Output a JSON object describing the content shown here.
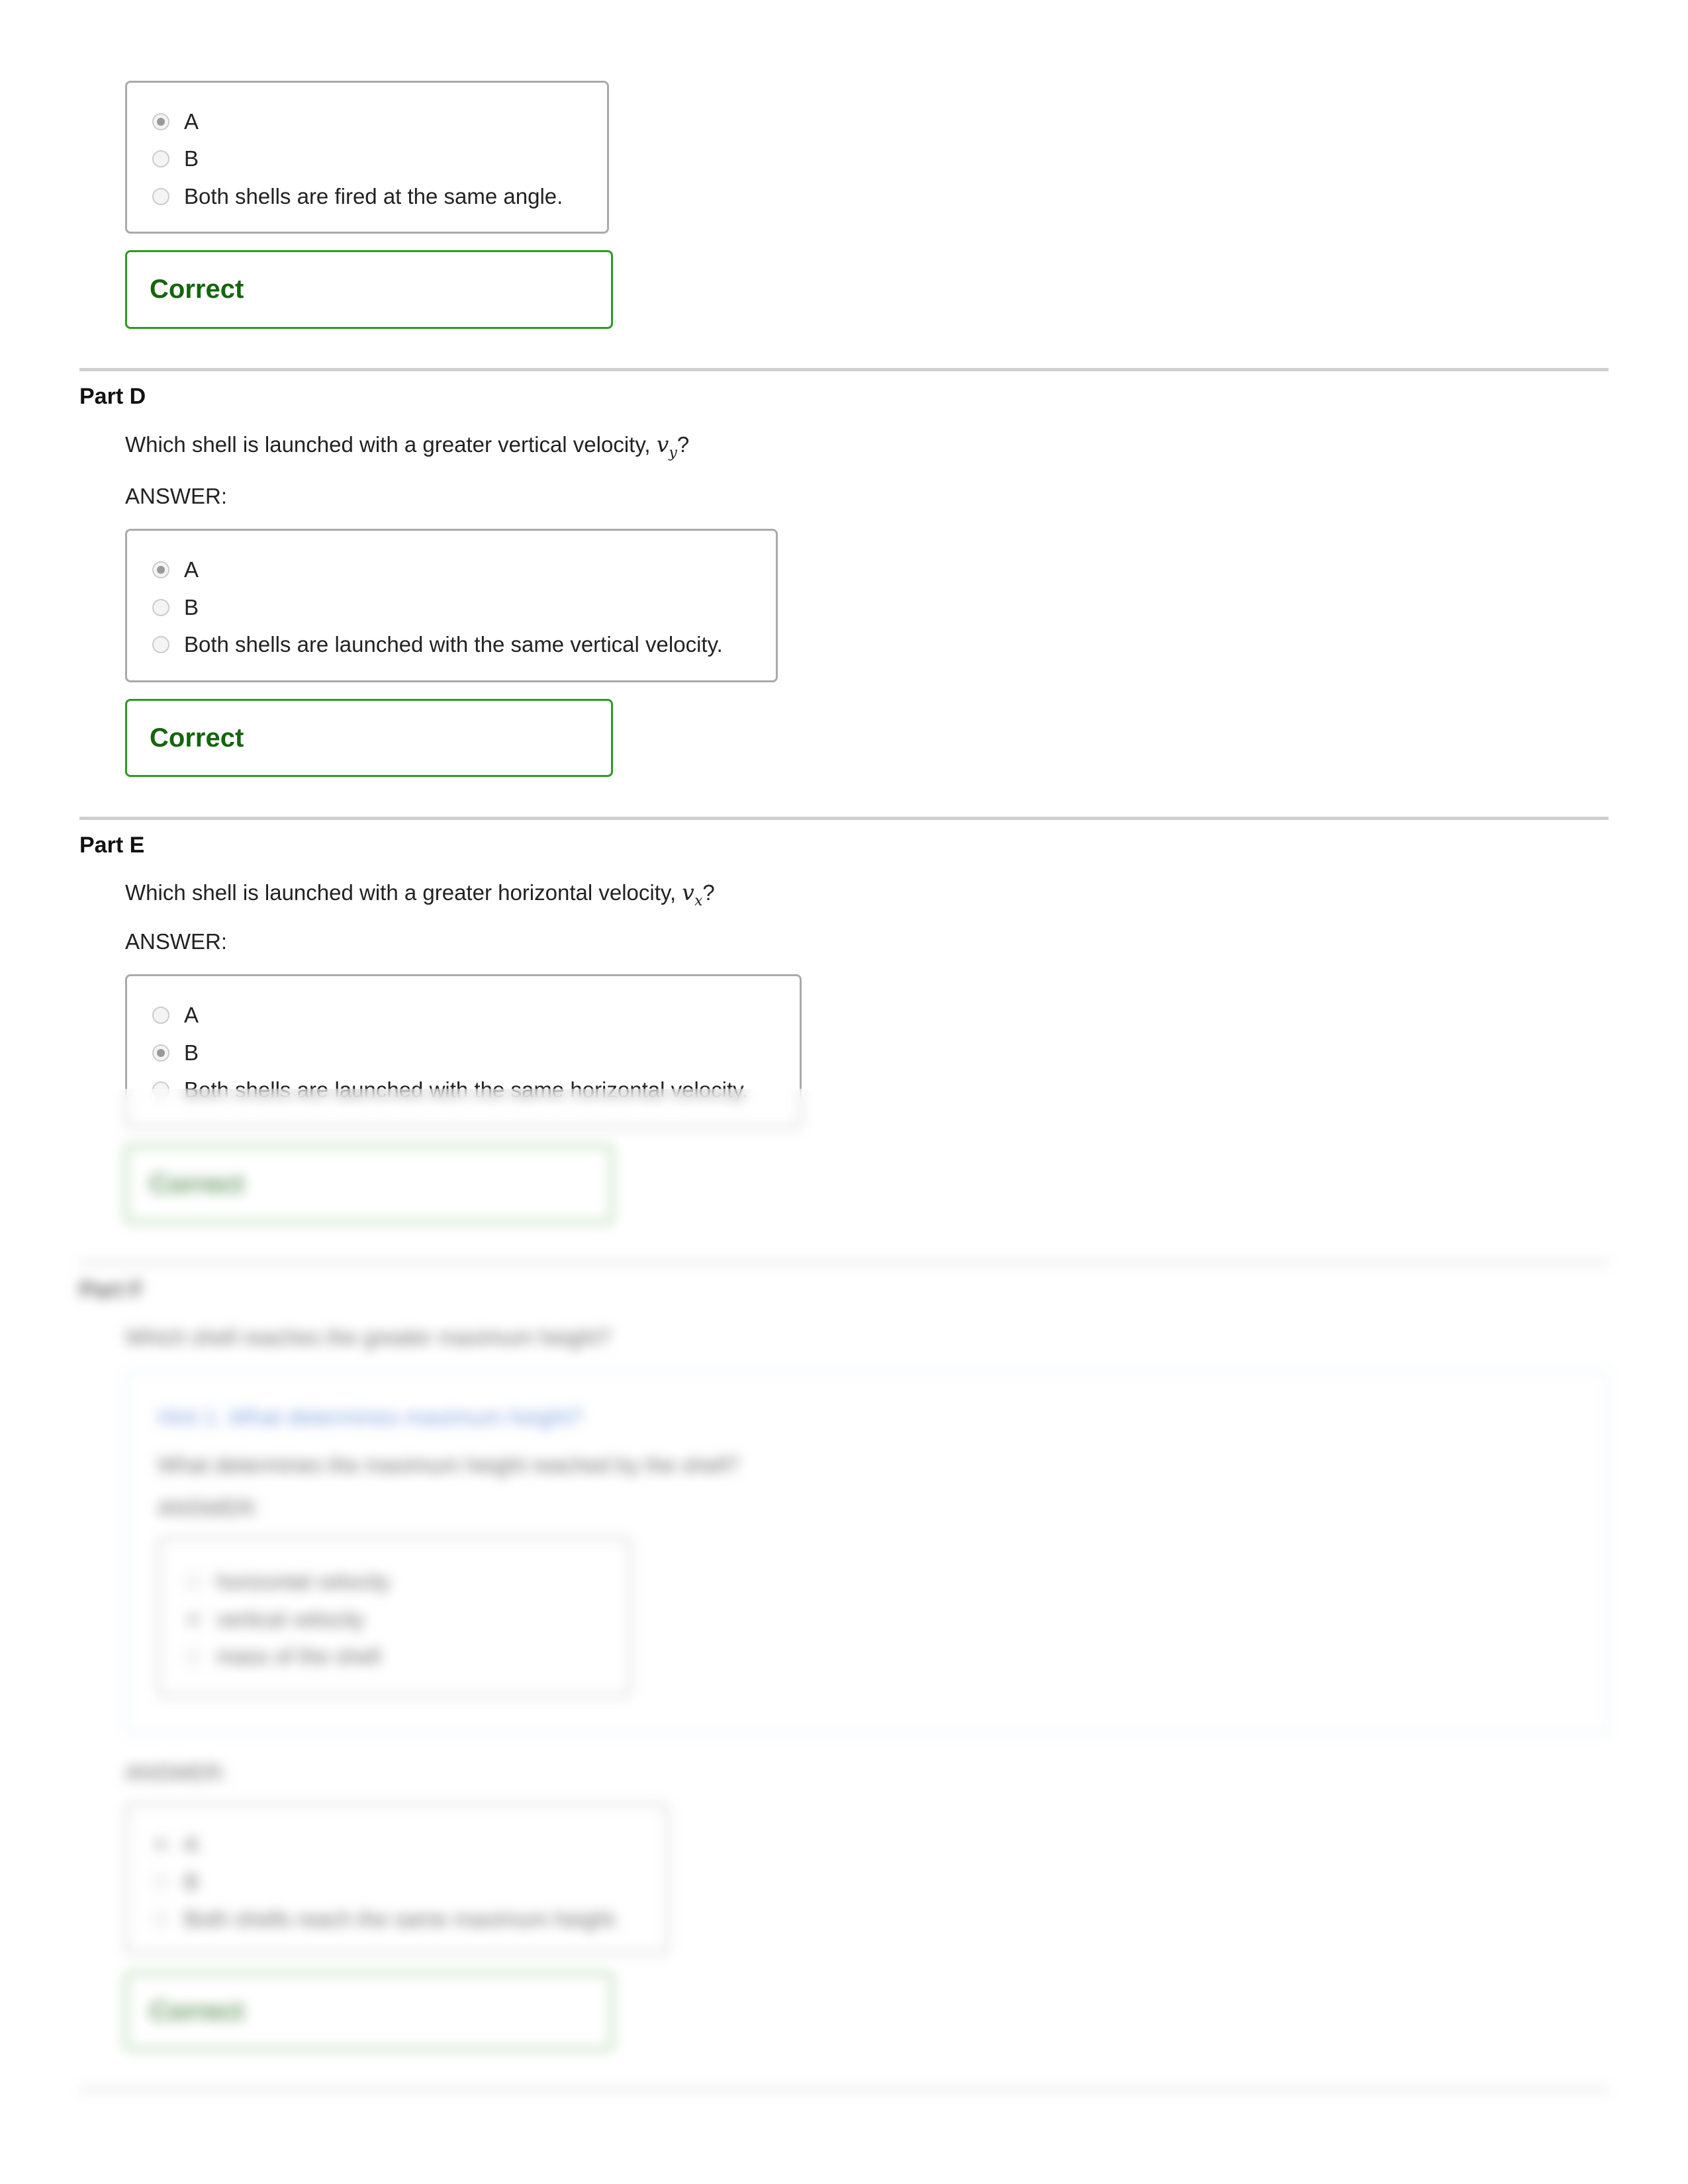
{
  "part_c": {
    "options": [
      "A",
      "B",
      "Both shells are fired at the same angle."
    ],
    "selected": 0,
    "feedback": "Correct"
  },
  "part_d": {
    "title": "Part D",
    "question_prefix": "Which shell is launched with a greater vertical velocity, ",
    "math_var": "v",
    "math_sub": "y",
    "question_suffix": "?",
    "answer_label": "ANSWER:",
    "options": [
      "A",
      "B",
      "Both shells are launched with the same vertical velocity."
    ],
    "selected": 0,
    "feedback": "Correct"
  },
  "part_e": {
    "title": "Part E",
    "question_prefix": "Which shell is launched with a greater horizontal velocity, ",
    "math_var": "v",
    "math_sub": "x",
    "question_suffix": "?",
    "answer_label": "ANSWER:",
    "options": [
      "A",
      "B",
      "Both shells are launched with the same horizontal velocity."
    ],
    "selected": 1,
    "feedback": "Correct"
  },
  "part_f": {
    "title": "Part F",
    "question": "Which shell reaches the greater maximum height?",
    "hint": {
      "title": "Hint 1. What determines maximum height?",
      "text": "What determines the maximum height reached by the shell?",
      "answer_label": "ANSWER:",
      "options": [
        "horizontal velocity",
        "vertical velocity",
        "mass of the shell"
      ],
      "selected": 1
    },
    "answer_label": "ANSWER:",
    "options": [
      "A",
      "B",
      "Both shells reach the same maximum height."
    ],
    "selected": 0,
    "feedback": "Correct"
  },
  "colors": {
    "correct_border": "#2e9a22",
    "correct_text": "#16640f",
    "hint_title": "#3a6fd0"
  }
}
